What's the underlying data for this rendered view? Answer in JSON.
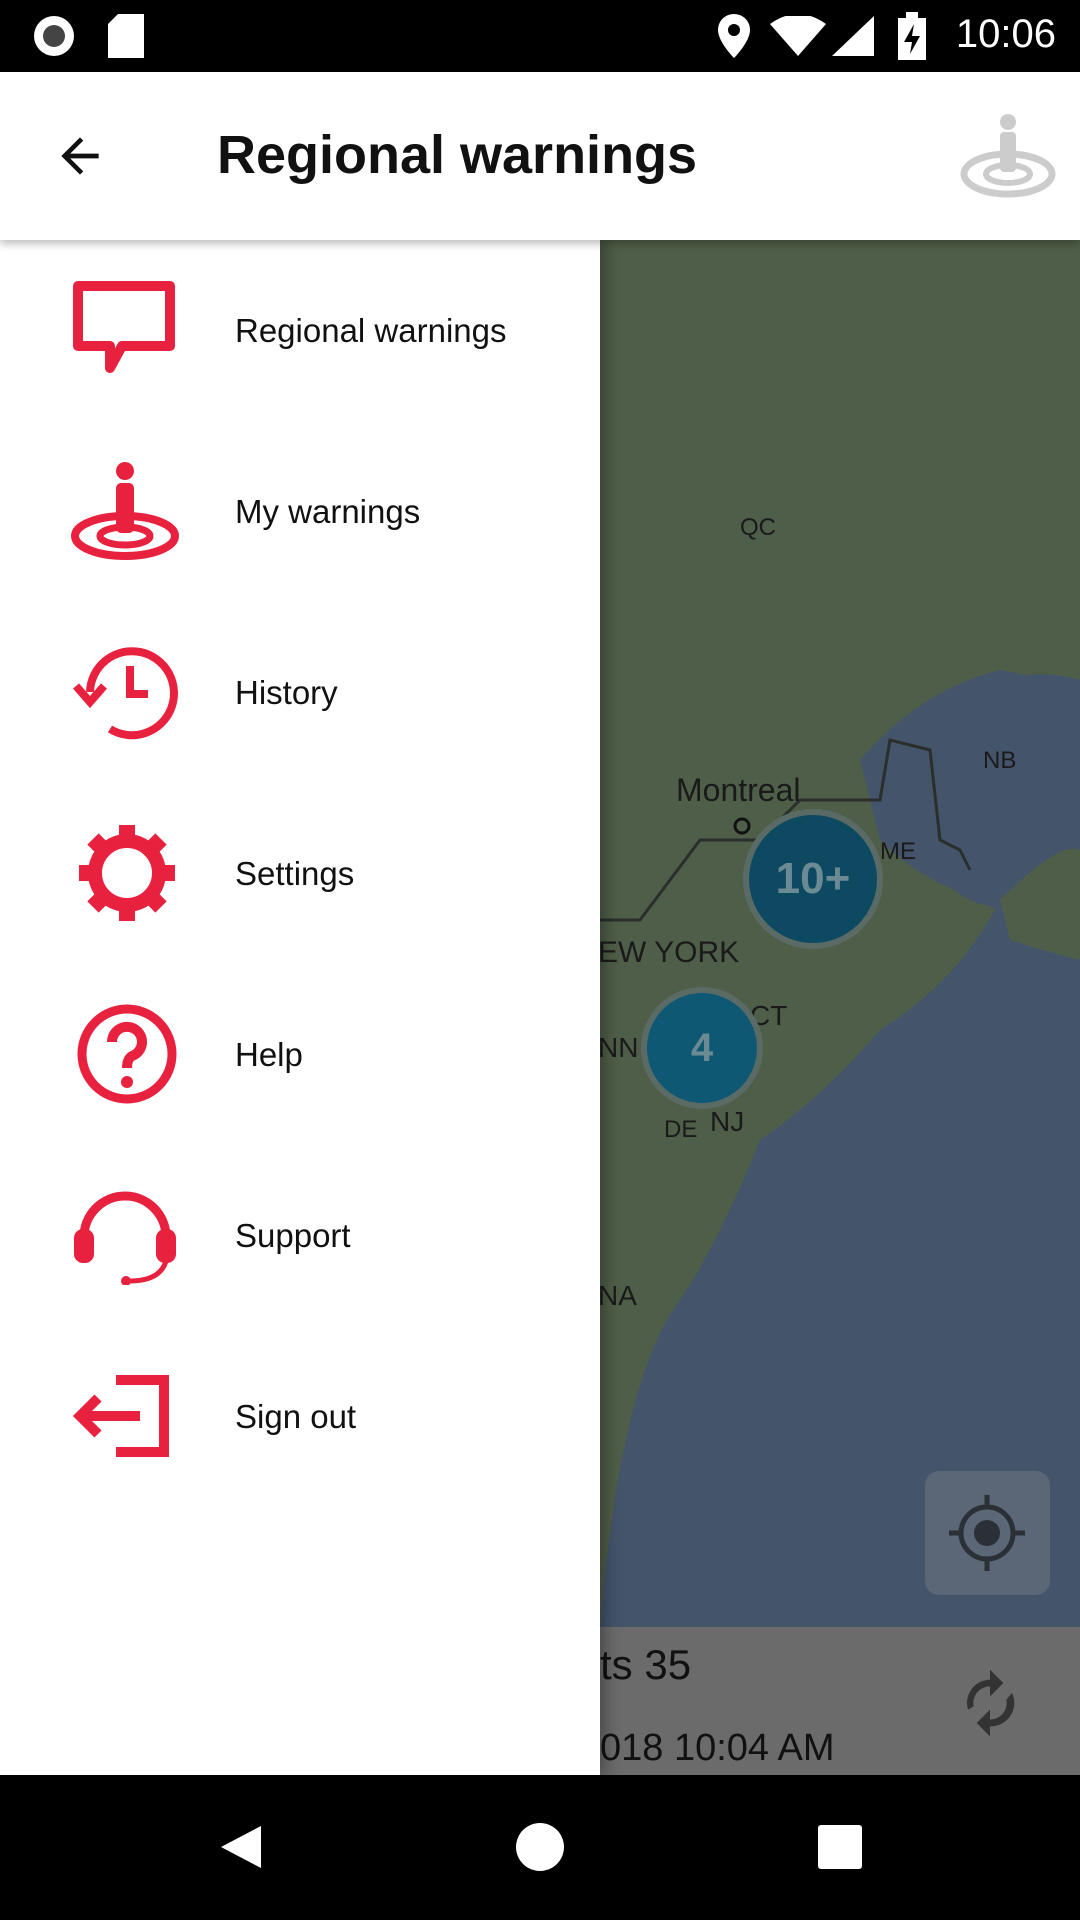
{
  "status_bar": {
    "time": "10:06",
    "icons": [
      "record-icon",
      "sd-card-icon",
      "location-icon",
      "wifi-icon",
      "signal-icon",
      "battery-charging-icon"
    ]
  },
  "app_bar": {
    "title": "Regional warnings",
    "back_icon": "arrow-back-icon",
    "right_icon": "my-location-person-icon"
  },
  "drawer": {
    "accent": "#e8213f",
    "items": [
      {
        "label": "Regional warnings",
        "icon": "speech-bubble-icon"
      },
      {
        "label": "My warnings",
        "icon": "person-pin-icon"
      },
      {
        "label": "History",
        "icon": "history-icon"
      },
      {
        "label": "Settings",
        "icon": "gear-icon"
      },
      {
        "label": "Help",
        "icon": "help-icon"
      },
      {
        "label": "Support",
        "icon": "headset-icon"
      },
      {
        "label": "Sign out",
        "icon": "sign-out-icon"
      }
    ]
  },
  "map": {
    "labels": {
      "qc": "QC",
      "montreal": "Montreal",
      "nb": "NB",
      "me": "ME",
      "new_york": "EW YORK",
      "ct": "CT",
      "nn": "NN",
      "de": "DE",
      "nj": "NJ",
      "na": "NA"
    },
    "clusters": [
      {
        "label": "10+"
      },
      {
        "label": "4"
      }
    ],
    "cluster_color": "#0d5570"
  },
  "bottom_panel": {
    "count_text": "ts 35",
    "updated_text": "018 10:04 AM"
  }
}
